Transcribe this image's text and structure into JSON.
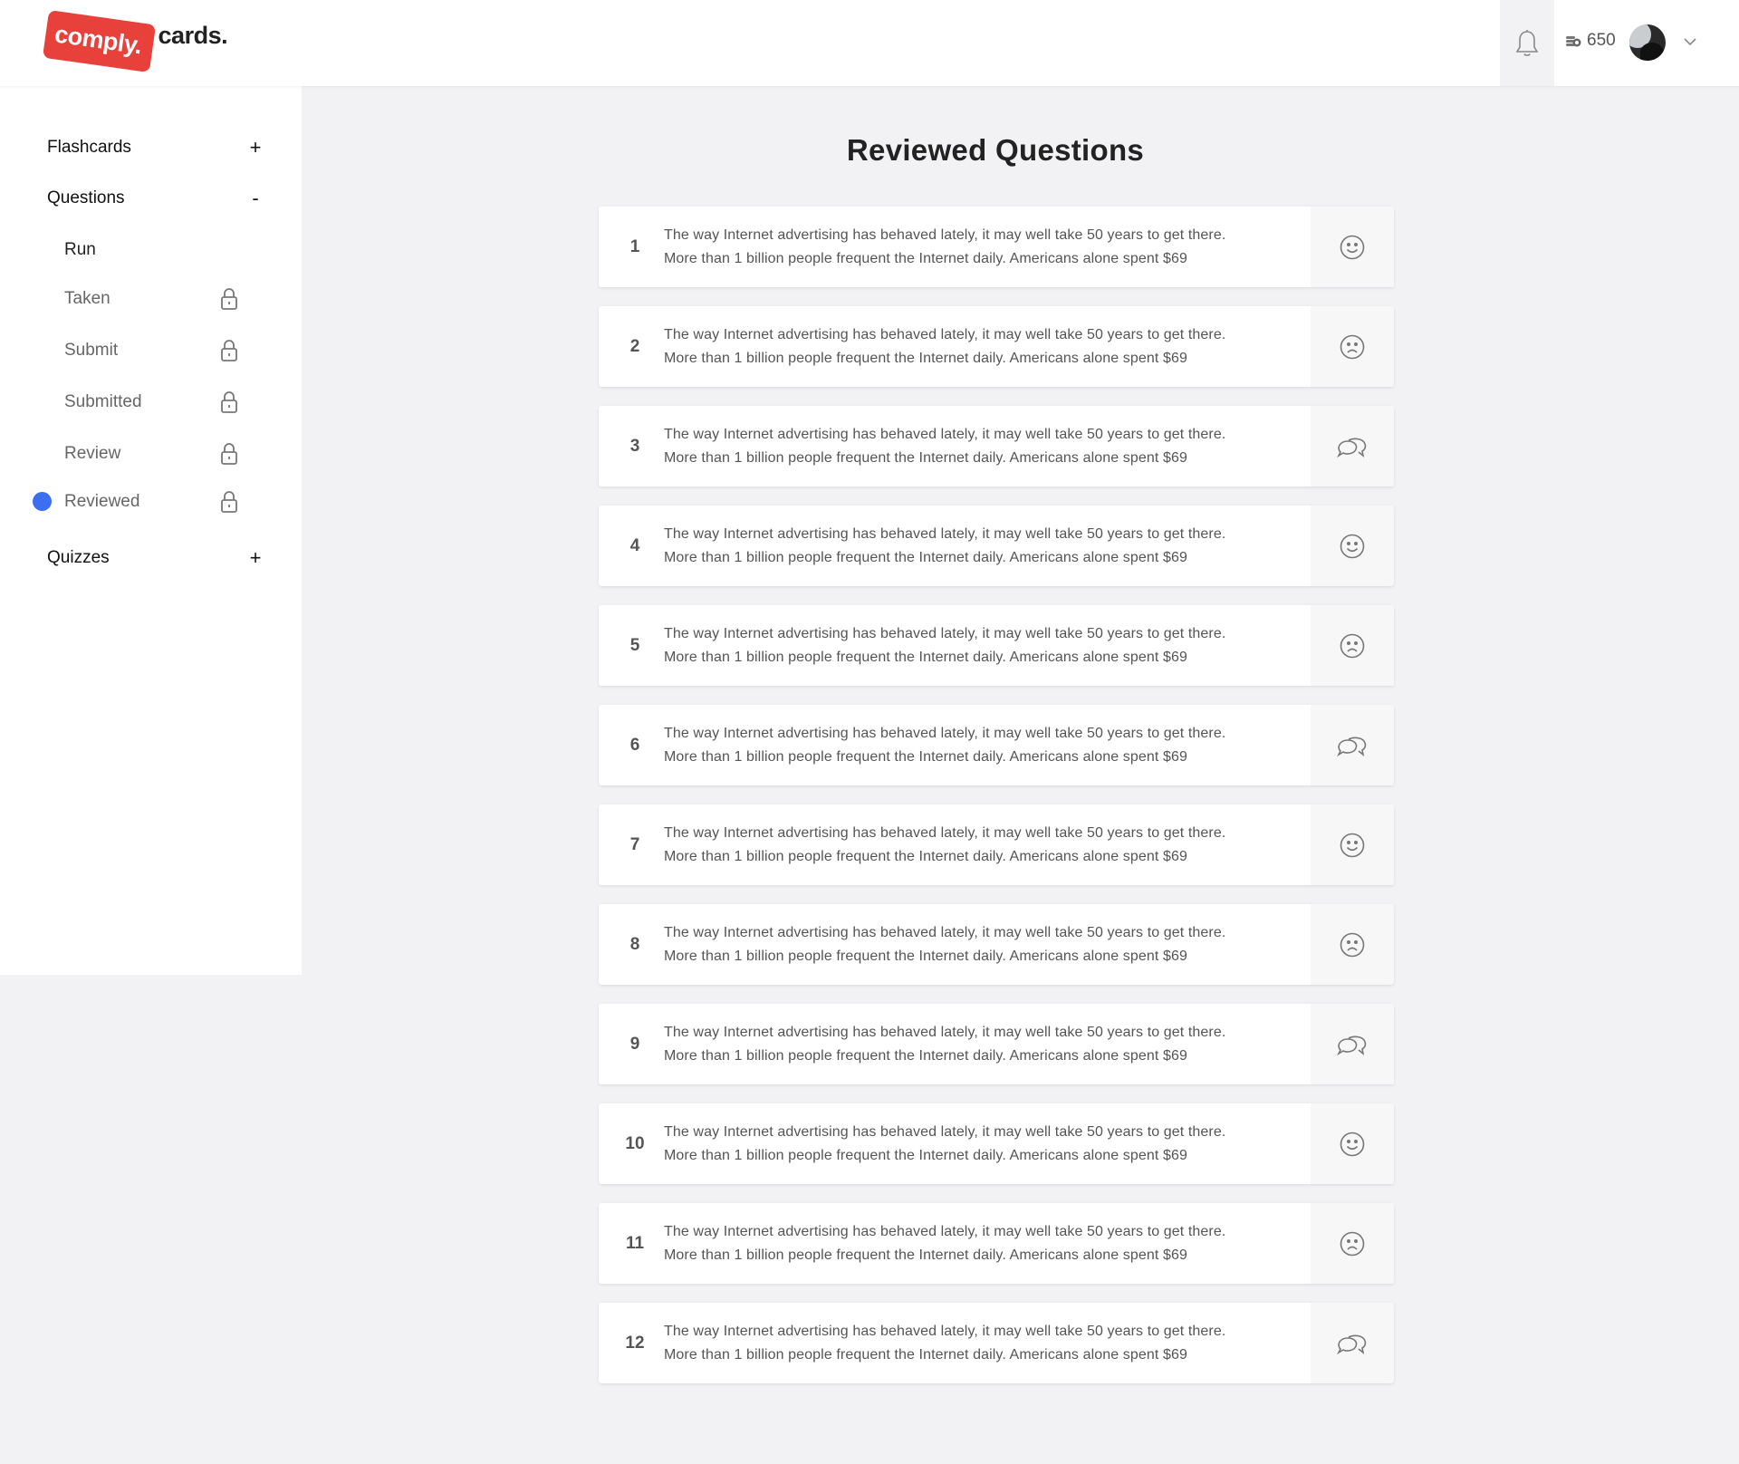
{
  "header": {
    "logo_badge": "comply.",
    "logo_text": "cards.",
    "coins": "650"
  },
  "sidebar": {
    "sections": [
      {
        "label": "Flashcards",
        "toggle": "+"
      },
      {
        "label": "Questions",
        "toggle": "-"
      },
      {
        "label": "Quizzes",
        "toggle": "+"
      }
    ],
    "question_items": [
      {
        "label": "Run",
        "locked": false,
        "active": false
      },
      {
        "label": "Taken",
        "locked": true,
        "active": false
      },
      {
        "label": "Submit",
        "locked": true,
        "active": false
      },
      {
        "label": "Submitted",
        "locked": true,
        "active": false
      },
      {
        "label": "Review",
        "locked": true,
        "active": false
      },
      {
        "label": "Reviewed",
        "locked": true,
        "active": true
      }
    ]
  },
  "main": {
    "title": "Reviewed Questions",
    "questions": [
      {
        "num": "1",
        "line1": "The way Internet advertising has behaved lately, it may well take 50 years to get there.",
        "line2": "More than 1 billion people frequent the Internet daily. Americans alone spent $69",
        "status": "smile-icon"
      },
      {
        "num": "2",
        "line1": "The way Internet advertising has behaved lately, it may well take 50 years to get there.",
        "line2": "More than 1 billion people frequent the Internet daily. Americans alone spent $69",
        "status": "frown-icon"
      },
      {
        "num": "3",
        "line1": "The way Internet advertising has behaved lately, it may well take 50 years to get there.",
        "line2": "More than 1 billion people frequent the Internet daily. Americans alone spent $69",
        "status": "chat-icon"
      },
      {
        "num": "4",
        "line1": "The way Internet advertising has behaved lately, it may well take 50 years to get there.",
        "line2": "More than 1 billion people frequent the Internet daily. Americans alone spent $69",
        "status": "smile-icon"
      },
      {
        "num": "5",
        "line1": "The way Internet advertising has behaved lately, it may well take 50 years to get there.",
        "line2": "More than 1 billion people frequent the Internet daily. Americans alone spent $69",
        "status": "frown-icon"
      },
      {
        "num": "6",
        "line1": "The way Internet advertising has behaved lately, it may well take 50 years to get there.",
        "line2": "More than 1 billion people frequent the Internet daily. Americans alone spent $69",
        "status": "chat-icon"
      },
      {
        "num": "7",
        "line1": "The way Internet advertising has behaved lately, it may well take 50 years to get there.",
        "line2": "More than 1 billion people frequent the Internet daily. Americans alone spent $69",
        "status": "smile-icon"
      },
      {
        "num": "8",
        "line1": "The way Internet advertising has behaved lately, it may well take 50 years to get there.",
        "line2": "More than 1 billion people frequent the Internet daily. Americans alone spent $69",
        "status": "frown-icon"
      },
      {
        "num": "9",
        "line1": "The way Internet advertising has behaved lately, it may well take 50 years to get there.",
        "line2": "More than 1 billion people frequent the Internet daily. Americans alone spent $69",
        "status": "chat-icon"
      },
      {
        "num": "10",
        "line1": "The way Internet advertising has behaved lately, it may well take 50 years to get there.",
        "line2": "More than 1 billion people frequent the Internet daily. Americans alone spent $69",
        "status": "smile-icon"
      },
      {
        "num": "11",
        "line1": "The way Internet advertising has behaved lately, it may well take 50 years to get there.",
        "line2": "More than 1 billion people frequent the Internet daily. Americans alone spent $69",
        "status": "frown-icon"
      },
      {
        "num": "12",
        "line1": "The way Internet advertising has behaved lately, it may well take 50 years to get there.",
        "line2": "More than 1 billion people frequent the Internet daily. Americans alone spent $69",
        "status": "chat-icon"
      }
    ]
  },
  "colors": {
    "brand": "#e8403a",
    "active_dot": "#3b6ef1",
    "background": "#f2f2f5"
  }
}
